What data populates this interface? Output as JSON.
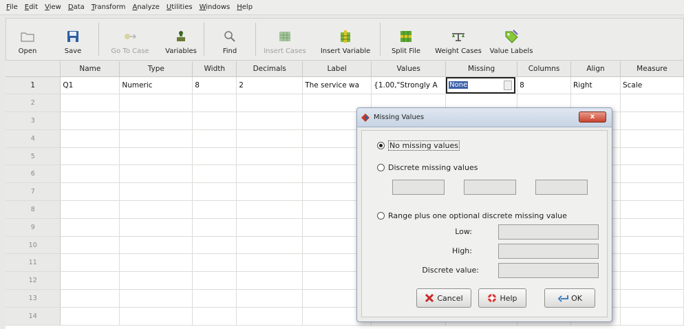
{
  "menu": [
    "File",
    "Edit",
    "View",
    "Data",
    "Transform",
    "Analyze",
    "Utilities",
    "Windows",
    "Help"
  ],
  "toolbar": {
    "open": "Open",
    "save": "Save",
    "go_to_case": "Go To Case",
    "variables": "Variables",
    "find": "Find",
    "insert_cases": "Insert Cases",
    "insert_variable": "Insert Variable",
    "split_file": "Split File",
    "weight_cases": "Weight Cases",
    "value_labels": "Value Labels"
  },
  "grid": {
    "columns": [
      "Name",
      "Type",
      "Width",
      "Decimals",
      "Label",
      "Values",
      "Missing",
      "Columns",
      "Align",
      "Measure"
    ],
    "row_numbers": [
      "1",
      "2",
      "3",
      "4",
      "5",
      "6",
      "7",
      "8",
      "9",
      "10",
      "11",
      "12",
      "13",
      "14"
    ],
    "row1": {
      "name": "Q1",
      "type": "Numeric",
      "width": "8",
      "decimals": "2",
      "label": "The service wa",
      "values": "{1.00,\"Strongly A",
      "missing": "None",
      "columns": "8",
      "align": "Right",
      "measure": "Scale"
    }
  },
  "dialog": {
    "title": "Missing Values",
    "close": "x",
    "no_missing": "No missing values",
    "discrete": "Discrete missing values",
    "range": "Range plus one optional discrete missing value",
    "low": "Low:",
    "high": "High:",
    "discrete_value": "Discrete value:",
    "cancel": "Cancel",
    "help": "Help",
    "ok": "OK",
    "selected_option": "no_missing"
  }
}
